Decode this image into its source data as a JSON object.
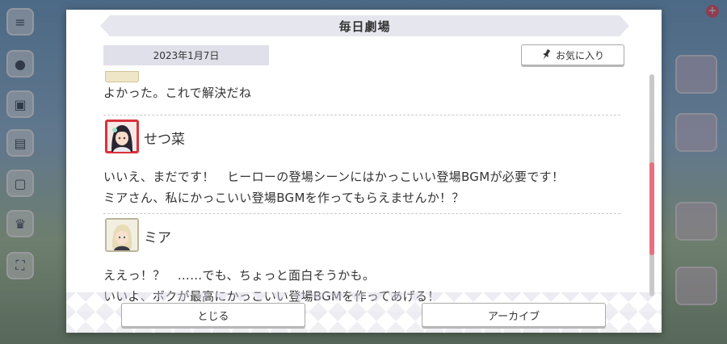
{
  "dialog": {
    "title": "毎日劇場",
    "date": "2023年1月7日",
    "favorite_label": "お気に入り",
    "close_label": "とじる",
    "archive_label": "アーカイブ"
  },
  "entries": [
    {
      "speaker": "",
      "lines": [
        "よかった。これで解決だね"
      ]
    },
    {
      "speaker": "せつ菜",
      "lines": [
        "いいえ、まだです！　ヒーローの登場シーンにはかっこいい登場BGMが必要です！",
        "ミアさん、私にかっこいい登場BGMを作ってもらえませんか！？"
      ]
    },
    {
      "speaker": "ミア",
      "lines": [
        "ええっ！？　……でも、ちょっと面白そうかも。",
        "いいよ、ボクが最高にかっこいい登場BGMを作ってあげる！"
      ]
    }
  ],
  "scroll": {
    "position": 0.62
  },
  "colors": {
    "accent": "#e8707f",
    "title_bar": "#e6e6ee"
  },
  "icons": {
    "favorite": "pin-icon",
    "menu": "menu-icon"
  }
}
